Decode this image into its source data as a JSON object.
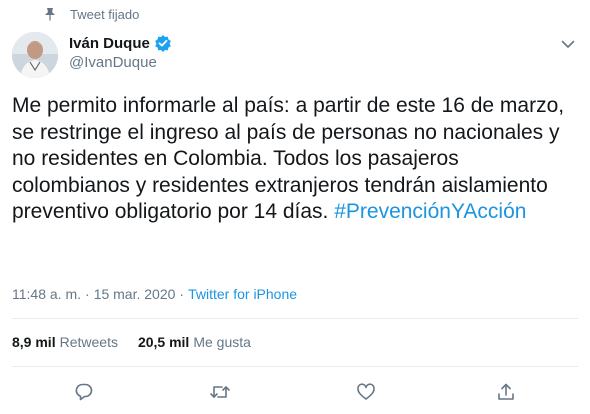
{
  "pinned": {
    "label": "Tweet fijado",
    "icon": "pin-icon"
  },
  "author": {
    "name": "Iván Duque",
    "handle": "@IvanDuque",
    "verified": true,
    "avatar_icon": "avatar"
  },
  "tweet": {
    "text": "Me permito informarle al país: a partir de este 16 de marzo, se restringe el ingreso al país de personas no nacionales y no residentes en Colombia. Todos los pasajeros colombianos y residentes extranjeros tendrán aislamiento preventivo obligatorio por 14 días.",
    "hashtag": "#PrevenciónYAcción"
  },
  "meta": {
    "time": "11:48 a. m.",
    "separator": "·",
    "date": "15 mar. 2020",
    "source": "Twitter for iPhone"
  },
  "stats": {
    "retweets_count": "8,9 mil",
    "retweets_label": "Retweets",
    "likes_count": "20,5 mil",
    "likes_label": "Me gusta"
  },
  "actions": [
    "reply-icon",
    "retweet-icon",
    "like-icon",
    "share-icon"
  ],
  "colors": {
    "link": "#1b95e0",
    "muted": "#657786",
    "text": "#14171a",
    "verified": "#1da1f2",
    "divider": "#e6ecf0"
  }
}
